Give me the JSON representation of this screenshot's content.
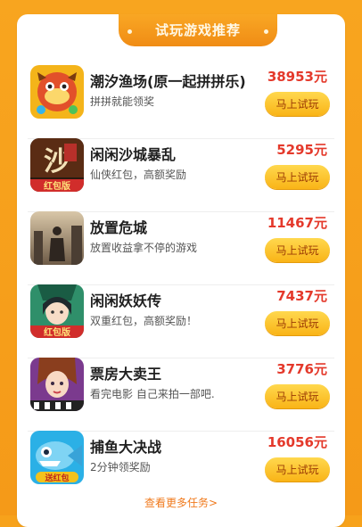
{
  "header": {
    "title": "试玩游戏推荐"
  },
  "games": [
    {
      "name": "潮汐渔场(原一起拼拼乐)",
      "desc": "拼拼就能领奖",
      "reward": "38953元",
      "button": "马上试玩",
      "icon": "fish-farm-game-icon",
      "badge": ""
    },
    {
      "name": "闲闲沙城暴乱",
      "desc": "仙侠红包，高额奖励",
      "reward": "5295元",
      "button": "马上试玩",
      "icon": "sand-city-game-icon",
      "badge": "红包版"
    },
    {
      "name": "放置危城",
      "desc": "放置收益拿不停的游戏",
      "reward": "11467元",
      "button": "马上试玩",
      "icon": "danger-city-game-icon",
      "badge": ""
    },
    {
      "name": "闲闲妖妖传",
      "desc": "双重红包，高额奖励！",
      "reward": "7437元",
      "button": "马上试玩",
      "icon": "fairy-legend-game-icon",
      "badge": "红包版"
    },
    {
      "name": "票房大卖王",
      "desc": "看完电影 自己来拍一部吧.",
      "reward": "3776元",
      "button": "马上试玩",
      "icon": "box-office-game-icon",
      "badge": ""
    },
    {
      "name": "捕鱼大决战",
      "desc": "2分钟领奖励",
      "reward": "16056元",
      "button": "马上试玩",
      "icon": "fishing-battle-game-icon",
      "badge": "送红包"
    }
  ],
  "footer": {
    "more_link": "查看更多任务>"
  },
  "colors": {
    "background": "#f7a21b",
    "reward": "#e4392b",
    "button": "#ffd84e",
    "link": "#f07a1d"
  }
}
